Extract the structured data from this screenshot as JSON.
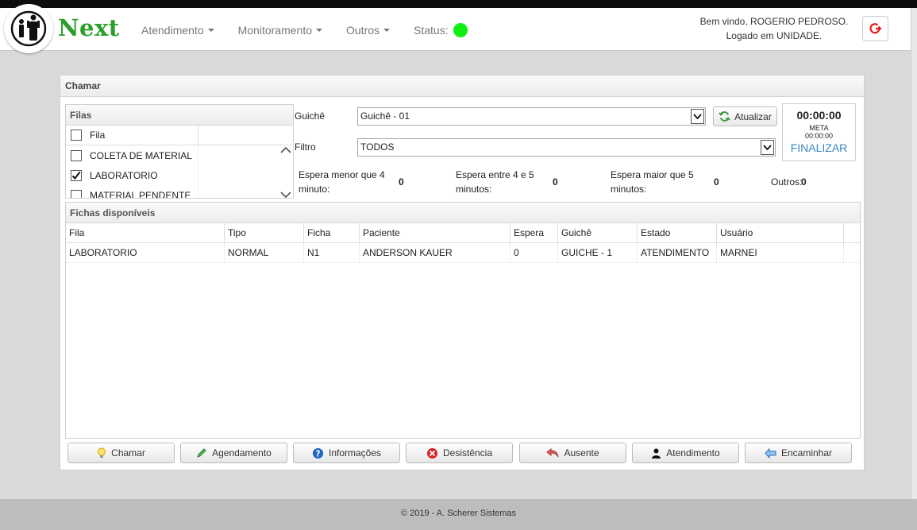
{
  "navbar": {
    "brand": "Next",
    "menu": [
      {
        "label": "Atendimento"
      },
      {
        "label": "Monitoramento"
      },
      {
        "label": "Outros"
      }
    ],
    "status_label": "Status:",
    "welcome_line1": "Bem vindo, ROGERIO PEDROSO.",
    "welcome_line2": "Logado em UNIDADE.",
    "status_color": "#11ee11"
  },
  "panel": {
    "title": "Chamar",
    "filas": {
      "title": "Filas",
      "header": "Fila",
      "rows": [
        {
          "label": "COLETA DE MATERIAL",
          "checked": false
        },
        {
          "label": "LABORATORIO",
          "checked": true
        },
        {
          "label": "MATERIAL PENDENTE",
          "checked": false
        }
      ]
    },
    "guiche_label": "Guichê",
    "guiche_value": "Guichê - 01",
    "filtro_label": "Filtro",
    "filtro_value": "TODOS",
    "atualizar_label": "Atualizar",
    "timer": {
      "time": "00:00:00",
      "meta_label": "META",
      "meta_time": "00:00:00",
      "finalizar": "FINALIZAR"
    },
    "stats": {
      "menor_label": "Espera menor que 4 minuto:",
      "menor_value": "0",
      "entre_label": "Espera entre 4 e 5 minutos:",
      "entre_value": "0",
      "maior_label": "Espera maior que 5 minutos:",
      "maior_value": "0",
      "outros_label": "Outros:",
      "outros_value": "0"
    },
    "fichas": {
      "title": "Fichas disponíveis",
      "columns": [
        "Fila",
        "Tipo",
        "Ficha",
        "Paciente",
        "Espera",
        "Guichê",
        "Estado",
        "Usuário"
      ],
      "rows": [
        [
          "LABORATORIO",
          "NORMAL",
          "N1",
          "ANDERSON KAUER",
          "0",
          "GUICHE - 1",
          "ATENDIMENTO",
          "MARNEI"
        ]
      ]
    },
    "actions": [
      {
        "label": "Chamar",
        "icon": "lightbulb-icon"
      },
      {
        "label": "Agendamento",
        "icon": "pencil-icon"
      },
      {
        "label": "Informações",
        "icon": "help-icon"
      },
      {
        "label": "Desistência",
        "icon": "cancel-icon"
      },
      {
        "label": "Ausente",
        "icon": "undo-arrow-icon"
      },
      {
        "label": "Atendimento",
        "icon": "user-icon"
      },
      {
        "label": "Encaminhar",
        "icon": "arrow-left-icon"
      }
    ]
  },
  "footer": {
    "text": "© 2019 - A. Scherer Sistemas"
  }
}
